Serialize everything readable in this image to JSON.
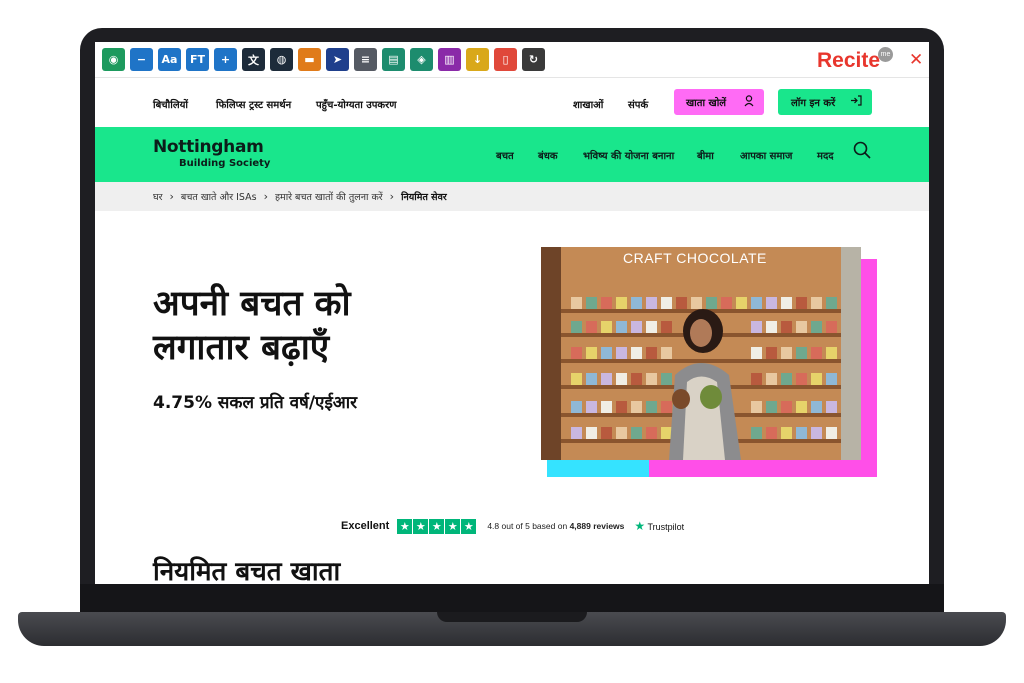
{
  "recite_toolbar": {
    "buttons": [
      {
        "icon": "speech-bubble-icon",
        "color": "#1d9a5e",
        "label": ""
      },
      {
        "icon": "minus-icon",
        "color": "#1f74c7",
        "label": ""
      },
      {
        "icon": "font-size-icon",
        "color": "#1f74c7",
        "label": "Aa"
      },
      {
        "icon": "font-type-icon",
        "color": "#1f74c7",
        "label": "FT"
      },
      {
        "icon": "plus-icon",
        "color": "#1f74c7",
        "label": ""
      },
      {
        "icon": "translate-icon",
        "color": "#1d2b3a",
        "label": ""
      },
      {
        "icon": "color-wheel-icon",
        "color": "#1d2b3a",
        "label": ""
      },
      {
        "icon": "ruler-icon",
        "color": "#e07b1a",
        "label": ""
      },
      {
        "icon": "cursor-icon",
        "color": "#1f3f8c",
        "label": ""
      },
      {
        "icon": "screen-mask-icon",
        "color": "#555a63",
        "label": ""
      },
      {
        "icon": "reader-icon",
        "color": "#1d8c6e",
        "label": ""
      },
      {
        "icon": "layers-icon",
        "color": "#1d8c6e",
        "label": ""
      },
      {
        "icon": "dictionary-icon",
        "color": "#8a2aa8",
        "label": ""
      },
      {
        "icon": "download-icon",
        "color": "#d9a81a",
        "label": ""
      },
      {
        "icon": "pdf-icon",
        "color": "#e0483a",
        "label": ""
      },
      {
        "icon": "reset-icon",
        "color": "#3a3a3a",
        "label": ""
      }
    ],
    "brand": "Recite",
    "brand_badge": "me"
  },
  "utility_nav": {
    "left_links": [
      "बिचौलियों",
      "फिलिप्स ट्रस्ट समर्थन",
      "पहुँच-योग्यता उपकरण"
    ],
    "right_links": [
      "शाखाओं",
      "संपर्क"
    ],
    "open_account": "खाता खोलें",
    "login": "लॉग इन करें"
  },
  "header": {
    "logo_main": "Nottingham",
    "logo_sub": "Building Society",
    "nav": [
      "बचत",
      "बंधक",
      "भविष्य की योजना बनाना",
      "बीमा",
      "आपका समाज",
      "मदद"
    ]
  },
  "breadcrumb": {
    "items": [
      "घर",
      "बचत खाते और ISAs",
      "हमारे बचत खातों की तुलना करें"
    ],
    "current": "नियमित सेवर"
  },
  "hero": {
    "title_line1": "अपनी बचत को",
    "title_line2": "लगातार बढ़ाएँ",
    "rate": "4.75% सकल प्रति वर्ष/एईआर",
    "image_caption": "CRAFT CHOCOLATE"
  },
  "trustpilot": {
    "rating_word": "Excellent",
    "score_text": "4.8 out of 5 based on",
    "reviews": "4,889 reviews",
    "brand": "Trustpilot"
  },
  "section": {
    "title": "नियमित बचत खाता"
  }
}
